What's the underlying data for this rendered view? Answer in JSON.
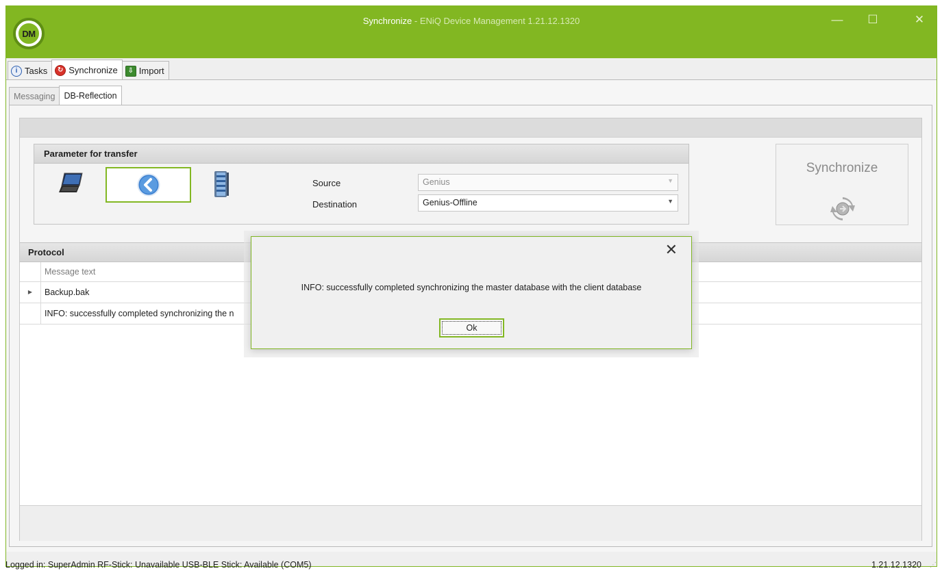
{
  "window": {
    "logo_text": "DM",
    "title_main": "Synchronize",
    "title_sub": " - ENiQ Device Management 1.21.12.1320",
    "controls": {
      "minimize": "—",
      "maximize": "☐",
      "close": "✕"
    },
    "accent_color": "#82b722"
  },
  "main_tabs": [
    {
      "label": "Tasks",
      "icon": "info-icon"
    },
    {
      "label": "Synchronize",
      "icon": "sync-icon",
      "active": true
    },
    {
      "label": "Import",
      "icon": "import-icon"
    }
  ],
  "sub_tabs": [
    {
      "label": "Messaging"
    },
    {
      "label": "DB-Reflection",
      "active": true
    }
  ],
  "parameters": {
    "title": "Parameter for transfer",
    "source_label": "Source",
    "source_value": "Genius",
    "destination_label": "Destination",
    "destination_value": "Genius-Offline",
    "direction_icon": "arrow-left-icon"
  },
  "synchronize_button": {
    "label": "Synchronize",
    "icon": "sync-arrows-icon"
  },
  "protocol": {
    "title": "Protocol",
    "column_header": "Message text",
    "rows": [
      {
        "text": "Backup.bak",
        "expandable": true
      },
      {
        "text": "INFO: successfully completed synchronizing the n"
      }
    ]
  },
  "status_bar": {
    "text": "Logged in: SuperAdmin   RF-Stick: Unavailable   USB-BLE Stick: Available (COM5)",
    "version": "1.21.12.1320"
  },
  "dialog": {
    "message": "INFO: successfully completed synchronizing the master database with the client database",
    "ok_label": "Ok",
    "close_label": "✕"
  }
}
